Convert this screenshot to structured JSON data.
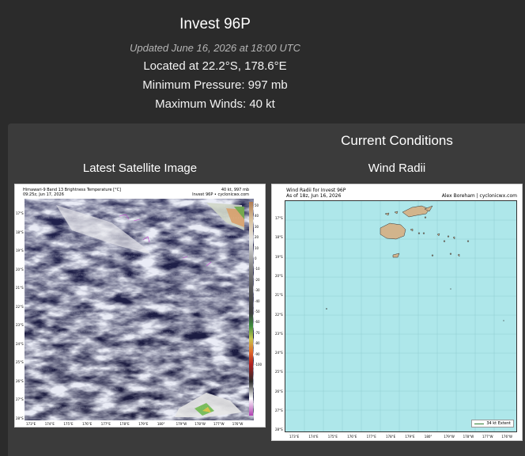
{
  "storm": {
    "title": "Invest 96P",
    "updated": "Updated June 16, 2026 at 18:00 UTC",
    "location": "Located at 22.2°S, 178.6°E",
    "pressure": "Minimum Pressure: 997 mb",
    "winds": "Maximum Winds: 40 kt"
  },
  "conditions": {
    "heading": "Current Conditions",
    "satellite_title": "Latest Satellite Image",
    "wind_radii_title": "Wind Radii"
  },
  "satellite": {
    "line1": "Himawari-9 Band 13 Brightness Temperature [°C]",
    "line2": "09:25z, Jun 17, 2026",
    "line3": "40 kt, 997 mb",
    "line4": "Invest 96P • cyclonicwx.com",
    "lat_ticks": [
      "17°S",
      "18°S",
      "19°S",
      "20°S",
      "21°S",
      "22°S",
      "23°S",
      "24°S",
      "25°S",
      "26°S",
      "27°S",
      "28°S"
    ],
    "lon_ticks": [
      "173°E",
      "174°E",
      "175°E",
      "176°E",
      "177°E",
      "178°E",
      "179°E",
      "180°",
      "179°W",
      "178°W",
      "177°W",
      "176°W"
    ],
    "cbar_ticks": [
      "50",
      "40",
      "30",
      "20",
      "10",
      "0",
      "-10",
      "-20",
      "-30",
      "-40",
      "-50",
      "-60",
      "-70",
      "-80",
      "-90",
      "-100"
    ]
  },
  "wind_radii": {
    "line1": "Wind Radii for Invest 96P",
    "line2": "As of 18z, Jun 16, 2026",
    "line3": "Alex Boreham | cyclonicwx.com",
    "legend": "34 kt Extent",
    "lat_ticks": [
      "17°S",
      "18°S",
      "19°S",
      "20°S",
      "21°S",
      "22°S",
      "23°S",
      "24°S",
      "25°S",
      "26°S",
      "27°S",
      "28°S"
    ],
    "lon_ticks": [
      "173°E",
      "174°E",
      "175°E",
      "176°E",
      "177°E",
      "178°E",
      "179°E",
      "180°",
      "179°W",
      "178°W",
      "177°W",
      "176°W"
    ]
  }
}
